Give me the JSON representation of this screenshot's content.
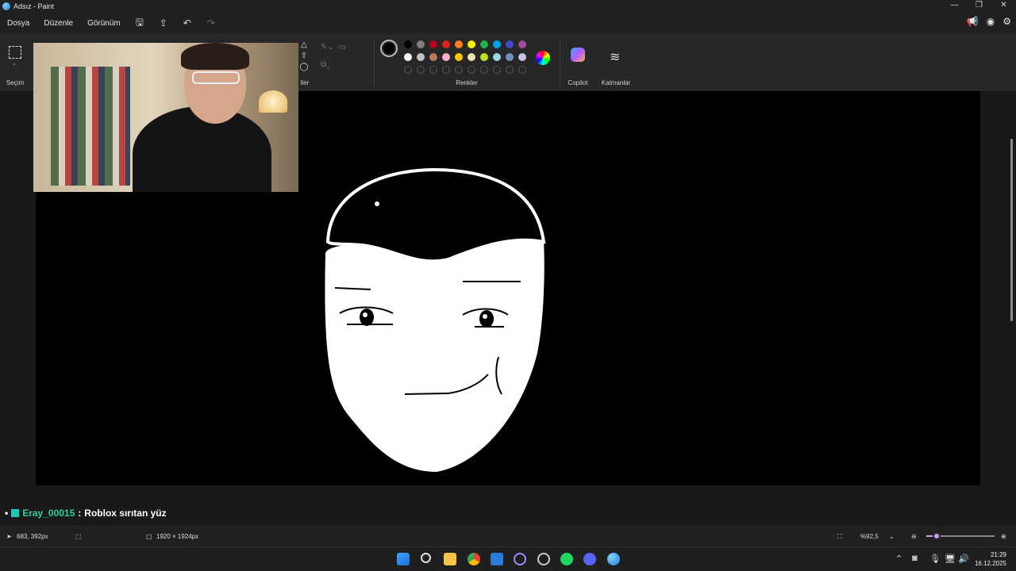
{
  "window": {
    "title": "Adsız - Paint",
    "controls": [
      "—",
      "❐",
      "✕"
    ]
  },
  "menu": {
    "items": [
      "Dosya",
      "Düzenle",
      "Görünüm"
    ]
  },
  "ribbon": {
    "selection_label": "Seçim",
    "shapes_label": "ller",
    "colors_label": "Renkler",
    "copilot_label": "Copilot",
    "layers_label": "Katmanlar",
    "current_color": "#000000",
    "secondary_color": "#ffffff",
    "palette_row1": [
      "#000000",
      "#7f7f7f",
      "#c00020",
      "#e0201f",
      "#ff7f27",
      "#fff200",
      "#22b14c",
      "#00a2e8",
      "#3f48cc",
      "#a349a4"
    ],
    "palette_row2": [
      "#ffffff",
      "#c3c3c3",
      "#b97a57",
      "#ffaec9",
      "#ffc90e",
      "#efe4b0",
      "#b5e61d",
      "#99d9ea",
      "#7092be",
      "#c8bfe7"
    ]
  },
  "chat": {
    "username": "Eray_00015",
    "separator": ":",
    "message": "Roblox sırıtan yüz"
  },
  "status": {
    "cursor_position": "683, 392px",
    "canvas_size": "1920 × 1924px",
    "zoom": "%92,5",
    "zoom_level": 0.15
  },
  "taskbar": {
    "time": "21:29",
    "date": "16.12.2025"
  }
}
